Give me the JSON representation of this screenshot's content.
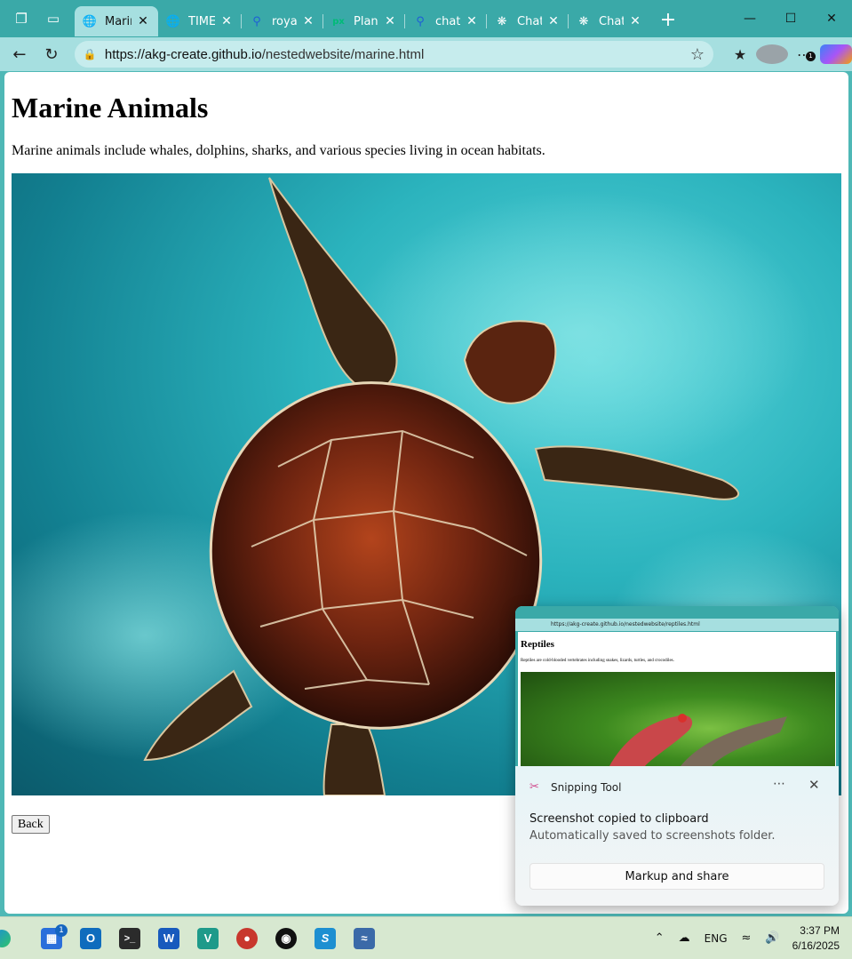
{
  "browser": {
    "tabs": [
      {
        "label": "Marine",
        "icon": "globe-icon",
        "active": true
      },
      {
        "label": "TIME",
        "icon": "globe-icon"
      },
      {
        "label": "royalt",
        "icon": "search-icon"
      },
      {
        "label": "Planet",
        "icon": "px-icon"
      },
      {
        "label": "chatg",
        "icon": "search-icon"
      },
      {
        "label": "ChatG",
        "icon": "chatgpt-icon"
      },
      {
        "label": "ChatG",
        "icon": "chatgpt-icon"
      }
    ],
    "url_domain": "https://akg-create.github.io",
    "url_path": "/nestedwebsite/marine.html",
    "notification_count": "1"
  },
  "page": {
    "title": "Marine Animals",
    "description": "Marine animals include whales, dolphins, sharks, and various species living in ocean habitats.",
    "back_label": "Back"
  },
  "toast": {
    "app_name": "Snipping Tool",
    "title": "Screenshot copied to clipboard",
    "subtitle": "Automatically saved to screenshots folder.",
    "action_label": "Markup and share",
    "thumbnail": {
      "url": "https://akg-create.github.io/nestedwebsite/reptiles.html",
      "heading": "Reptiles",
      "text": "Reptiles are cold-blooded vertebrates including snakes, lizards, turtles, and crocodiles."
    }
  },
  "taskbar": {
    "store_badge": "1",
    "language": "ENG",
    "time": "3:37 PM",
    "date": "6/16/2025"
  }
}
